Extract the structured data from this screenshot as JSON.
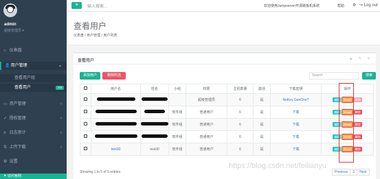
{
  "sidebar": {
    "user_name": "admin",
    "user_role": "超级管理员 ▾",
    "items": [
      {
        "icon": "home-icon",
        "glyph": "⌂",
        "label": "仪表盘"
      },
      {
        "icon": "user-icon",
        "glyph": "👤",
        "label": "用户管理"
      },
      {
        "icon": "desktop-icon",
        "glyph": "▭",
        "label": "资产管理"
      },
      {
        "icon": "shield-icon",
        "glyph": "✓",
        "label": "授权管理"
      },
      {
        "icon": "log-icon",
        "glyph": "≡",
        "label": "日志审计"
      },
      {
        "icon": "upload-icon",
        "glyph": "⇅",
        "label": "上传下载"
      },
      {
        "icon": "gear-icon",
        "glyph": "⚙",
        "label": "设置"
      },
      {
        "icon": "link-icon",
        "glyph": "⚑",
        "label": "访问官网"
      }
    ],
    "subitems": [
      {
        "label": "查看用户组"
      },
      {
        "label": "查看用户",
        "badge": "5/5"
      }
    ]
  },
  "topbar": {
    "menu_glyph": "≡",
    "search_placeholder": "输入搜索...",
    "welcome": "欢迎使用Jumpserver开源跳板机系统",
    "help": "帮助",
    "logout": "Log out"
  },
  "header": {
    "title": "查看用户",
    "breadcrumb": "仪表盘  /  用户管理  /  用户列表"
  },
  "panel": {
    "title": "查看用户",
    "tools": "▲ ✎ ✕",
    "add_label": "添加用户",
    "delete_label": "删除所选",
    "search_placeholder": "Search",
    "search_button": "搜索"
  },
  "table": {
    "headers": [
      "",
      "用户名",
      "姓名",
      "小组",
      "权限",
      "主机数量",
      "激活",
      "下载密钥",
      "操作"
    ],
    "rows": [
      {
        "username": "",
        "name": "",
        "group": "",
        "role": "超级管理员",
        "hosts": "6",
        "active": "是",
        "key": "NoKey GenOne?",
        "username_w": 56,
        "name_w": 38
      },
      {
        "username": "",
        "name": "",
        "group": "软件组",
        "role": "普通用户",
        "hosts": "6",
        "active": "是",
        "key": "下载",
        "username_w": 60,
        "name_w": 30
      },
      {
        "username": "",
        "name": "",
        "group": "软件组",
        "role": "普通用户",
        "hosts": "6",
        "active": "是",
        "key": "下载",
        "username_w": 60,
        "name_w": 40
      },
      {
        "username": "",
        "name": "",
        "group": "软件组",
        "role": "普通用户",
        "hosts": "6",
        "active": "是",
        "key": "下载",
        "username_w": 62,
        "name_w": 38
      },
      {
        "username": "test30",
        "name": "test30",
        "group": "软件组",
        "role": "普通用户",
        "hosts": "6",
        "active": "是",
        "key": "下载",
        "username_w": 0,
        "name_w": 0
      }
    ],
    "op_edit": "编辑",
    "op_email": "Email",
    "op_delete": "删除"
  },
  "footer": {
    "info": "Showing 1 to 5 of 5 entries",
    "prev": "Previous",
    "page": "1",
    "next": "Next"
  },
  "watermark": "https://blog.csdn.net/feilianyu"
}
